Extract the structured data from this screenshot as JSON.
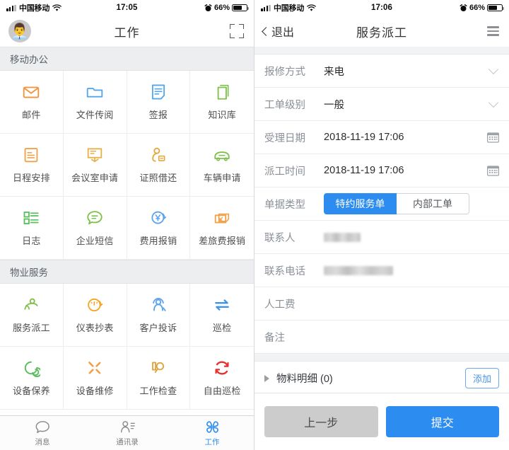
{
  "left": {
    "status": {
      "carrier": "中国移动",
      "time": "17:05",
      "battery_pct": "66%"
    },
    "nav": {
      "title": "工作",
      "avatar_glyph": "👨‍💼",
      "scan_icon": "scan-icon"
    },
    "sections": [
      {
        "title": "移动办公",
        "items": [
          {
            "label": "邮件",
            "icon": "mail-icon",
            "color": "#f29339"
          },
          {
            "label": "文件传阅",
            "icon": "folder-icon",
            "color": "#53a7ee"
          },
          {
            "label": "签报",
            "icon": "document-sign-icon",
            "color": "#53a7ee"
          },
          {
            "label": "知识库",
            "icon": "book-stack-icon",
            "color": "#7fc04a"
          },
          {
            "label": "日程安排",
            "icon": "schedule-icon",
            "color": "#f0a14a"
          },
          {
            "label": "会议室申请",
            "icon": "meeting-room-icon",
            "color": "#e8b04b"
          },
          {
            "label": "证照借还",
            "icon": "license-borrow-icon",
            "color": "#e3a93f"
          },
          {
            "label": "车辆申请",
            "icon": "car-icon",
            "color": "#7fc04a"
          },
          {
            "label": "日志",
            "icon": "log-list-icon",
            "color": "#5bbf5f"
          },
          {
            "label": "企业短信",
            "icon": "sms-bubble-icon",
            "color": "#7fc04a"
          },
          {
            "label": "费用报销",
            "icon": "expense-yuan-icon",
            "color": "#5ba3ef"
          },
          {
            "label": "差旅费报销",
            "icon": "travel-expense-icon",
            "color": "#f0a14a"
          }
        ]
      },
      {
        "title": "物业服务",
        "items": [
          {
            "label": "服务派工",
            "icon": "dispatch-person-icon",
            "color": "#7fc04a"
          },
          {
            "label": "仪表抄表",
            "icon": "meter-reading-icon",
            "color": "#f5a623"
          },
          {
            "label": "客户投诉",
            "icon": "complaint-headset-icon",
            "color": "#5ba3ef"
          },
          {
            "label": "巡检",
            "icon": "patrol-arrows-icon",
            "color": "#3d94e8"
          },
          {
            "label": "设备保养",
            "icon": "maintenance-spiral-icon",
            "color": "#5bbf5f"
          },
          {
            "label": "设备维修",
            "icon": "repair-tools-icon",
            "color": "#f0a14a"
          },
          {
            "label": "工作检查",
            "icon": "work-check-icon",
            "color": "#e0a33f"
          },
          {
            "label": "自由巡检",
            "icon": "free-patrol-icon",
            "color": "#e8302f"
          }
        ]
      }
    ],
    "tabs": [
      {
        "label": "消息",
        "icon": "chat-bubble-icon",
        "active": false
      },
      {
        "label": "通讯录",
        "icon": "contacts-icon",
        "active": false
      },
      {
        "label": "工作",
        "icon": "work-grid-icon",
        "active": true
      }
    ]
  },
  "right": {
    "status": {
      "carrier": "中国移动",
      "time": "17:06",
      "battery_pct": "66%"
    },
    "nav": {
      "back_label": "退出",
      "title": "服务派工",
      "menu_icon": "hamburger-list-icon"
    },
    "fields": [
      {
        "label": "报修方式",
        "value": "来电",
        "control": "select",
        "icon": "chevron-down-icon"
      },
      {
        "label": "工单级别",
        "value": "一般",
        "control": "select",
        "icon": "chevron-down-icon"
      },
      {
        "label": "受理日期",
        "value": "2018-11-19 17:06",
        "control": "date",
        "icon": "calendar-icon"
      },
      {
        "label": "派工时间",
        "value": "2018-11-19 17:06",
        "control": "date",
        "icon": "calendar-icon"
      }
    ],
    "doc_type": {
      "label": "单据类型",
      "options": [
        {
          "label": "特约服务单",
          "selected": true
        },
        {
          "label": "内部工单",
          "selected": false
        }
      ]
    },
    "redacted_fields": [
      {
        "label": "联系人",
        "value": "",
        "redacted": true,
        "redact_width": 52
      },
      {
        "label": "联系电话",
        "value": "",
        "redacted": true,
        "redact_width": 98
      }
    ],
    "empty_fields": [
      {
        "label": "人工费",
        "value": ""
      },
      {
        "label": "备注",
        "value": ""
      }
    ],
    "materials": {
      "title": "物料明细 (0)",
      "add_label": "添加",
      "expander": "triangle-right-icon"
    },
    "footer": {
      "prev_label": "上一步",
      "submit_label": "提交"
    }
  },
  "colors": {
    "accent": "#2d8cf0",
    "section_bg": "#eceef0",
    "muted": "#8a8f96",
    "danger": "#e8302f"
  }
}
